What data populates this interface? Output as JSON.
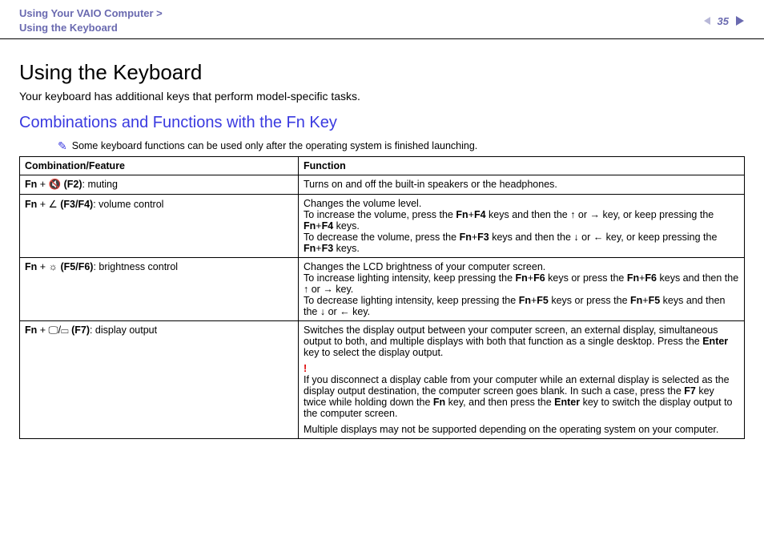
{
  "header": {
    "breadcrumb_line1": "Using Your VAIO Computer >",
    "breadcrumb_line2": "Using the Keyboard",
    "page_number": "35"
  },
  "page": {
    "title": "Using the Keyboard",
    "intro": "Your keyboard has additional keys that perform model-specific tasks.",
    "section_title": "Combinations and Functions with the Fn Key",
    "note": "Some keyboard functions can be used only after the operating system is finished launching."
  },
  "table": {
    "header_combo": "Combination/Feature",
    "header_func": "Function",
    "rows": [
      {
        "combo_prefix": "Fn",
        "combo_key": " (F2)",
        "combo_suffix": ": muting",
        "func_html": "Turns on and off the built-in speakers or the headphones."
      },
      {
        "combo_prefix": "Fn",
        "combo_key": " (F3/F4)",
        "combo_suffix": ": volume control",
        "func_line1": "Changes the volume level.",
        "func_line2a": "To increase the volume, press the ",
        "func_line2b": " keys and then the ",
        "func_line2c": " key, or keep pressing the ",
        "func_line2d": " keys.",
        "func_line3a": "To decrease the volume, press the ",
        "func_line3b": " keys and then the ",
        "func_line3c": " key, or keep pressing the ",
        "func_line3d": " keys.",
        "k_f4": "Fn",
        "k_f4b": "F4",
        "k_f3": "Fn",
        "k_f3b": "F3",
        "or": " or "
      },
      {
        "combo_prefix": "Fn",
        "combo_key": " (F5/F6)",
        "combo_suffix": ": brightness control",
        "func_line1": "Changes the LCD brightness of your computer screen.",
        "func_line2a": "To increase lighting intensity, keep pressing the ",
        "func_line2b": " keys or press the ",
        "func_line2c": " keys and then the ",
        "func_line2d": " key.",
        "func_line3a": "To decrease lighting intensity, keep pressing the ",
        "func_line3b": " keys or press the ",
        "func_line3c": " keys and then the ",
        "func_line3d": " key.",
        "k_f6": "Fn",
        "k_f6b": "F6",
        "k_f5": "Fn",
        "k_f5b": "F5",
        "or": " or "
      },
      {
        "combo_prefix": "Fn",
        "combo_key": " (F7)",
        "combo_suffix": ": display output",
        "func_p1a": "Switches the display output between your computer screen, an external display, simultaneous output to both, and multiple displays with both that function as a single desktop. Press the ",
        "func_p1_enter": "Enter",
        "func_p1b": " key to select the display output.",
        "func_excl": "!",
        "func_p2a": "If you disconnect a display cable from your computer while an external display is selected as the display output destination, the computer screen goes blank. In such a case, press the ",
        "func_p2_f7": "F7",
        "func_p2b": " key twice while holding down the ",
        "func_p2_fn": "Fn",
        "func_p2c": " key, and then press the ",
        "func_p2_enter": "Enter",
        "func_p2d": " key to switch the display output to the computer screen.",
        "func_p3": "Multiple displays may not be supported depending on the operating system on your computer."
      }
    ]
  }
}
